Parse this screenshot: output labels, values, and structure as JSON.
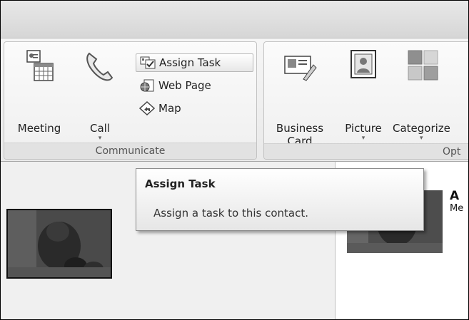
{
  "ribbon": {
    "communicate": {
      "label": "Communicate",
      "meeting_label": "Meeting",
      "call_label": "Call",
      "call_arrow": "▾",
      "assign_task_label": "Assign Task",
      "web_page_label": "Web Page",
      "map_label": "Map"
    },
    "options": {
      "label": "Opt",
      "business_card_label_line1": "Business",
      "business_card_label_line2": "Card",
      "picture_label": "Picture",
      "picture_arrow": "▾",
      "categorize_label": "Categorize",
      "categorize_arrow": "▾"
    }
  },
  "tooltip": {
    "title": "Assign Task",
    "body": "Assign a task to this contact."
  },
  "contact_card": {
    "name_partial": "A",
    "sub_partial": "Me"
  }
}
